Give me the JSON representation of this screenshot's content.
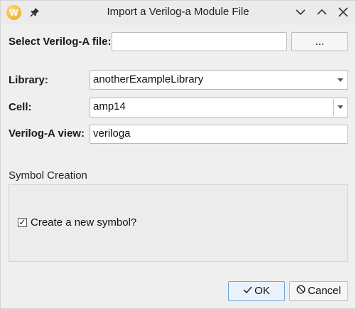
{
  "window": {
    "title": "Import a Verilog-a Module File",
    "app_icon_letter": "W",
    "icons": [
      "app-icon",
      "pin-icon",
      "minimize-icon",
      "maximize-icon",
      "close-icon"
    ]
  },
  "form": {
    "file_label": "Select Verilog-A file:",
    "file_value": "",
    "browse_label": "...",
    "library_label": "Library:",
    "library_value": "anotherExampleLibrary",
    "cell_label": "Cell:",
    "cell_value": "amp14",
    "view_label": "Verilog-A view:",
    "view_value": "veriloga"
  },
  "symbol_creation": {
    "title": "Symbol Creation",
    "checkbox_label": "Create a new symbol?",
    "checked": true,
    "check_glyph": "✓"
  },
  "buttons": {
    "ok_label": "OK",
    "cancel_label": "Cancel"
  }
}
